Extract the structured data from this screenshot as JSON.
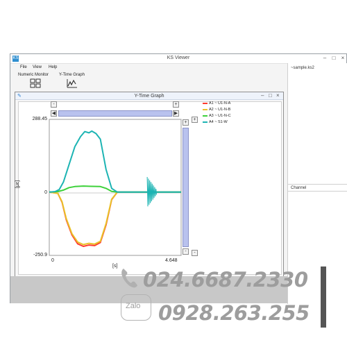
{
  "app": {
    "icon_text": "KS",
    "title": "KS Viewer",
    "window_controls": [
      "–",
      "□",
      "×"
    ]
  },
  "menu": [
    "File",
    "View",
    "Help"
  ],
  "toolbar": {
    "numeric_monitor_label": "Numeric Monitor",
    "ytime_graph_label": "Y-Time Graph"
  },
  "file_panel": {
    "entry": "~sample.ks2"
  },
  "channel_panel": {
    "header": "Channel"
  },
  "graph_window": {
    "title": "Y-Time Graph",
    "controls": [
      "–",
      "□",
      "×"
    ]
  },
  "scroll_buttons": {
    "plus": "+",
    "minus": "-",
    "left": "◀",
    "right": "▶"
  },
  "colors": {
    "A1": "#ff3b2f",
    "A2": "#e9c229",
    "A3": "#3dd13a",
    "A4": "#1cb4b3",
    "scrollbar": "#b9c2ee"
  },
  "chart_data": {
    "type": "line",
    "xlabel": "[s]",
    "ylabel": "[με]",
    "xlim": [
      0,
      4.648
    ],
    "ylim": [
      -250.9,
      288.45
    ],
    "x_tick_labels": [
      "0",
      "4.648"
    ],
    "y_tick_labels": [
      "288.45",
      "0",
      "-250.9"
    ],
    "legend_position": "right",
    "series": [
      {
        "name": "A1 ~ U1-N-A",
        "color": "#ff3b2f",
        "x": [
          0,
          0.3,
          0.45,
          0.6,
          0.8,
          1.0,
          1.2,
          1.4,
          1.6,
          1.8,
          2.0,
          2.2,
          2.4,
          3.5,
          4.648
        ],
        "y": [
          0,
          -5,
          -40,
          -110,
          -170,
          -205,
          -215,
          -210,
          -212,
          -200,
          -130,
          -30,
          0,
          0,
          0
        ]
      },
      {
        "name": "A2 ~ U1-N-B",
        "color": "#e9c229",
        "x": [
          0,
          0.3,
          0.45,
          0.6,
          0.8,
          1.0,
          1.2,
          1.4,
          1.6,
          1.8,
          2.0,
          2.2,
          2.4,
          3.5,
          4.648
        ],
        "y": [
          0,
          -5,
          -38,
          -105,
          -165,
          -198,
          -208,
          -203,
          -206,
          -195,
          -125,
          -28,
          0,
          0,
          0
        ]
      },
      {
        "name": "A3 ~ U1-N-C",
        "color": "#3dd13a",
        "x": [
          0,
          0.3,
          0.5,
          0.7,
          0.9,
          1.2,
          1.5,
          1.8,
          2.0,
          2.2,
          2.4,
          3.5,
          4.648
        ],
        "y": [
          0,
          2,
          8,
          18,
          22,
          24,
          23,
          22,
          15,
          3,
          0,
          0,
          0
        ]
      },
      {
        "name": "A4 ~ S1-W",
        "color": "#1cb4b3",
        "x": [
          0,
          0.2,
          0.35,
          0.5,
          0.7,
          0.9,
          1.1,
          1.25,
          1.4,
          1.5,
          1.65,
          1.8,
          2.0,
          2.2,
          2.4,
          3.5,
          4.648
        ],
        "y": [
          0,
          2,
          10,
          40,
          110,
          180,
          220,
          240,
          235,
          242,
          232,
          210,
          90,
          15,
          0,
          0,
          0
        ]
      }
    ],
    "burst": {
      "x": 3.55,
      "amplitude": 60
    }
  },
  "watermark": {
    "phone_1": "024.6687.2330",
    "zalo_label": "Zalo",
    "phone_2": "0928.263.255"
  }
}
